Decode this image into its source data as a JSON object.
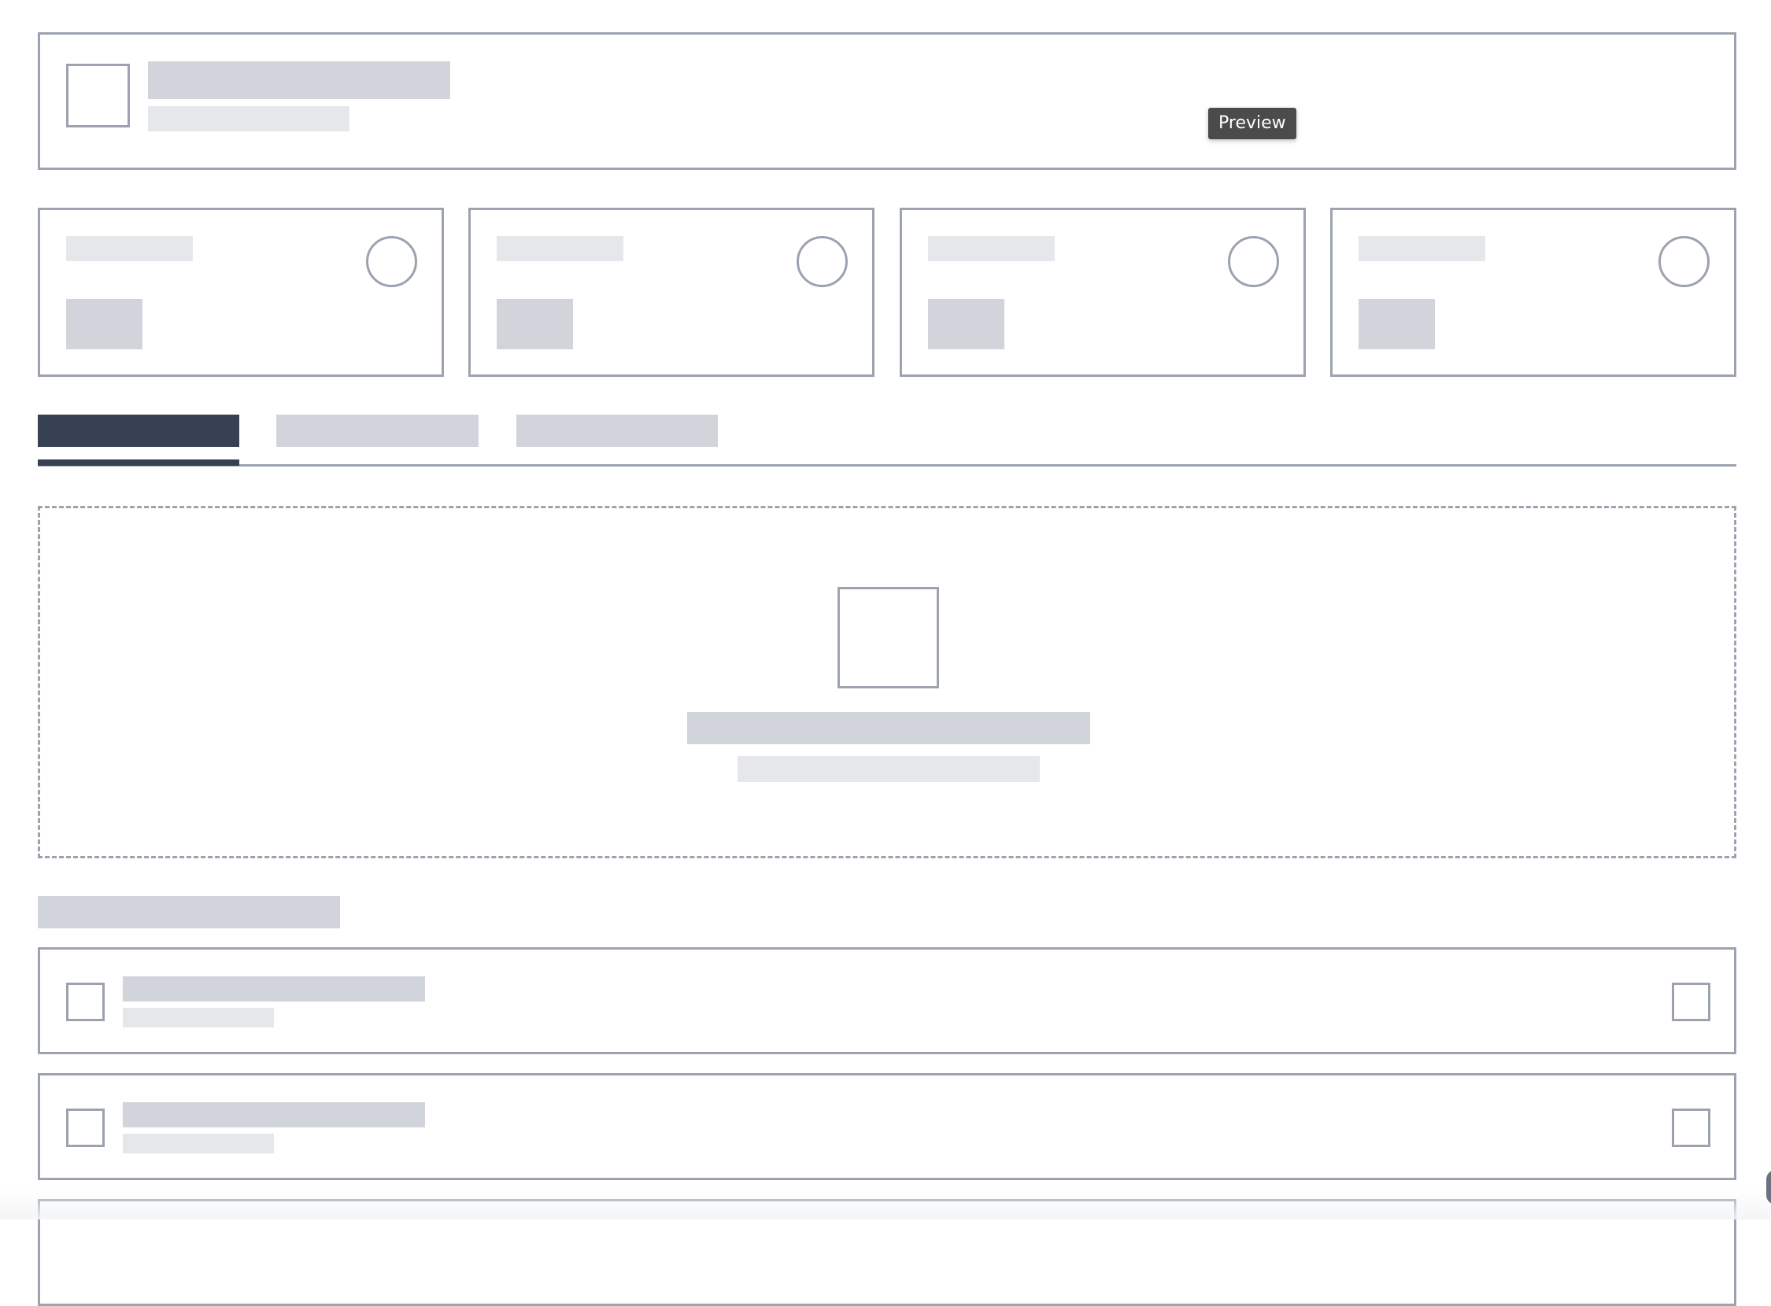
{
  "tooltip": {
    "text": "Preview"
  },
  "header": {
    "icon": "image-placeholder-icon"
  },
  "stat_cards": [
    {
      "icon": "circle-icon"
    },
    {
      "icon": "circle-icon"
    },
    {
      "icon": "circle-icon"
    },
    {
      "icon": "circle-icon"
    }
  ],
  "tabs": {
    "count": 3,
    "active_index": 0
  },
  "dropzone": {
    "icon": "image-placeholder-icon"
  },
  "list": {
    "items": [
      {
        "icon": "square-icon",
        "action_icon": "square-icon"
      },
      {
        "icon": "square-icon",
        "action_icon": "square-icon"
      },
      {
        "icon": "square-icon",
        "action_icon": "square-icon"
      }
    ]
  },
  "colors": {
    "border": "#9ca3af",
    "placeholder_dark": "#d1d5db",
    "placeholder_light": "#e5e7eb",
    "active_tab": "#374151",
    "tooltip_bg": "#4b4b4b"
  }
}
